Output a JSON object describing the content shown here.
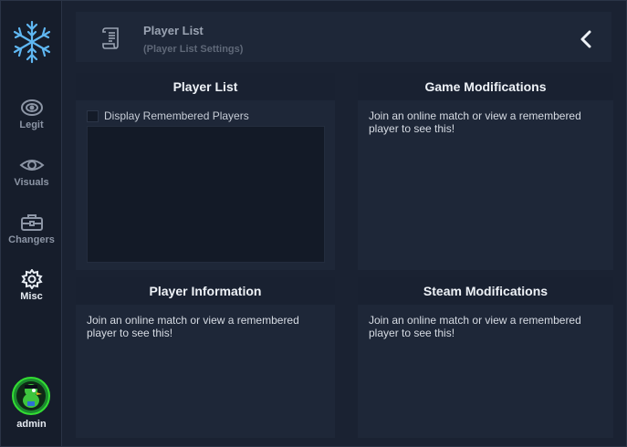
{
  "sidebar": {
    "logo_icon": "snowflake-icon",
    "items": [
      {
        "label": "Legit",
        "icon": "target-icon"
      },
      {
        "label": "Visuals",
        "icon": "eye-icon"
      },
      {
        "label": "Changers",
        "icon": "toolbox-icon"
      },
      {
        "label": "Misc",
        "icon": "gear-icon"
      }
    ],
    "active_item": "Misc",
    "user": {
      "name": "admin"
    }
  },
  "header": {
    "title": "Player List",
    "subtitle": "(Player List Settings)",
    "page_icon": "scroll-icon",
    "back_icon": "chevron-left-icon"
  },
  "panels": {
    "player_list": {
      "title": "Player List",
      "checkbox_label": "Display Remembered Players",
      "checkbox_checked": false
    },
    "game_modifications": {
      "title": "Game Modifications",
      "message": "Join an online match or view a remembered player to see this!"
    },
    "player_information": {
      "title": "Player Information",
      "message": "Join an online match or view a remembered player to see this!"
    },
    "steam_modifications": {
      "title": "Steam Modifications",
      "message": "Join an online match or view a remembered player to see this!"
    }
  },
  "colors": {
    "accent_snowflake": "#5fb7f2",
    "avatar_ring": "#33dd33"
  }
}
